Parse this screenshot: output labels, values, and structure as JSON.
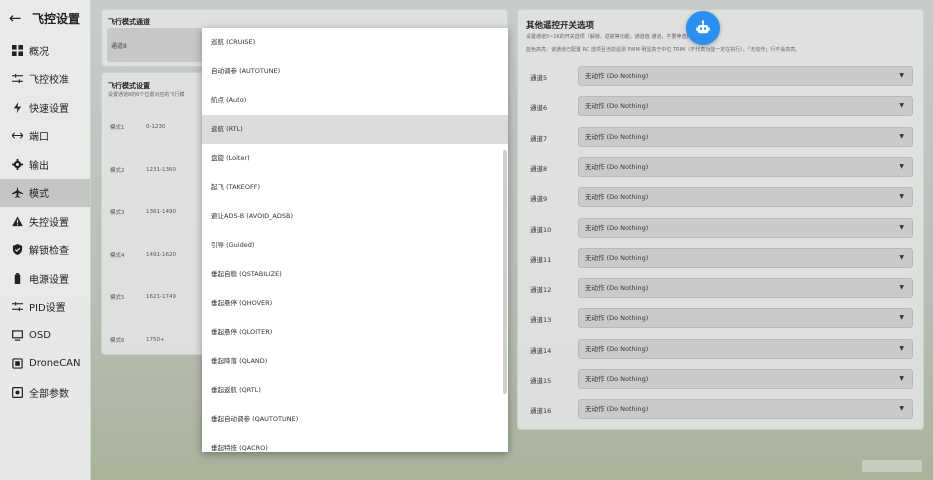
{
  "sidebar": {
    "title": "飞控设置",
    "back_icon": "arrow-left-icon",
    "items": [
      {
        "label": "概况",
        "icon": "dashboard-icon"
      },
      {
        "label": "飞控校准",
        "icon": "sliders-icon"
      },
      {
        "label": "快速设置",
        "icon": "bolt-icon"
      },
      {
        "label": "端口",
        "icon": "arrows-icon"
      },
      {
        "label": "输出",
        "icon": "gear-icon"
      },
      {
        "label": "模式",
        "icon": "plane-icon"
      },
      {
        "label": "失控设置",
        "icon": "warning-icon"
      },
      {
        "label": "解锁检查",
        "icon": "shield-icon"
      },
      {
        "label": "电源设置",
        "icon": "battery-icon"
      },
      {
        "label": "PID设置",
        "icon": "sliders-icon"
      },
      {
        "label": "OSD",
        "icon": "monitor-icon"
      },
      {
        "label": "DroneCAN",
        "icon": "chip-icon"
      },
      {
        "label": "全部参数",
        "icon": "settings-box-icon"
      }
    ],
    "active_index": 5
  },
  "flight_mode_channel": {
    "title": "飞行模式通道",
    "value": "通道8"
  },
  "flight_mode_settings": {
    "title": "飞行模式设置",
    "subtitle": "设置通道8的6个位置对应的飞行模",
    "modes": [
      {
        "name": "模式1",
        "range": "0-1230"
      },
      {
        "name": "模式2",
        "range": "1231-1360"
      },
      {
        "name": "模式3",
        "range": "1361-1490"
      },
      {
        "name": "模式4",
        "range": "1491-1620"
      },
      {
        "name": "模式5",
        "range": "1621-1749"
      },
      {
        "name": "模式6",
        "range": "1750+"
      }
    ]
  },
  "other_channels": {
    "title": "其他遥控开关选项",
    "subtitle1": "设置通道5~16的开关选项（解锁、返航等功能，通道值                        通道，不要伸选择）",
    "subtitle2": "蓝色高亮：该通道已配置 RC 选项且当前遥测 PWM 明显高于中位 TRIM（不代表功能一定在执行）。「无动作」行不会高亮。",
    "channels": [
      {
        "label": "通道5",
        "value": "无动作 (Do Nothing)"
      },
      {
        "label": "通道6",
        "value": "无动作 (Do Nothing)"
      },
      {
        "label": "通道7",
        "value": "无动作 (Do Nothing)"
      },
      {
        "label": "通道8",
        "value": "无动作 (Do Nothing)"
      },
      {
        "label": "通道9",
        "value": "无动作 (Do Nothing)"
      },
      {
        "label": "通道10",
        "value": "无动作 (Do Nothing)"
      },
      {
        "label": "通道11",
        "value": "无动作 (Do Nothing)"
      },
      {
        "label": "通道12",
        "value": "无动作 (Do Nothing)"
      },
      {
        "label": "通道13",
        "value": "无动作 (Do Nothing)"
      },
      {
        "label": "通道14",
        "value": "无动作 (Do Nothing)"
      },
      {
        "label": "通道15",
        "value": "无动作 (Do Nothing)"
      },
      {
        "label": "通道16",
        "value": "无动作 (Do Nothing)"
      }
    ]
  },
  "dropdown": {
    "options": [
      "巡航 (CRUISE)",
      "自动调参 (AUTOTUNE)",
      "航点 (Auto)",
      "返航 (RTL)",
      "盘旋 (Loiter)",
      "起飞 (TAKEOFF)",
      "避让ADS-B (AVOID_ADSB)",
      "引导 (Guided)",
      "垂起自稳 (QSTABILIZE)",
      "垂起悬停 (QHOVER)",
      "垂起悬停 (QLOITER)",
      "垂起降落 (QLAND)",
      "垂起返航 (QRTL)",
      "垂起自动调参 (QAUTOTUNE)",
      "垂起特技 (QACRO)"
    ],
    "selected_index": 3
  },
  "assistant_icon": "robot-icon",
  "colors": {
    "accent": "#2b8ff0",
    "active_nav": "#c4c6c4"
  }
}
